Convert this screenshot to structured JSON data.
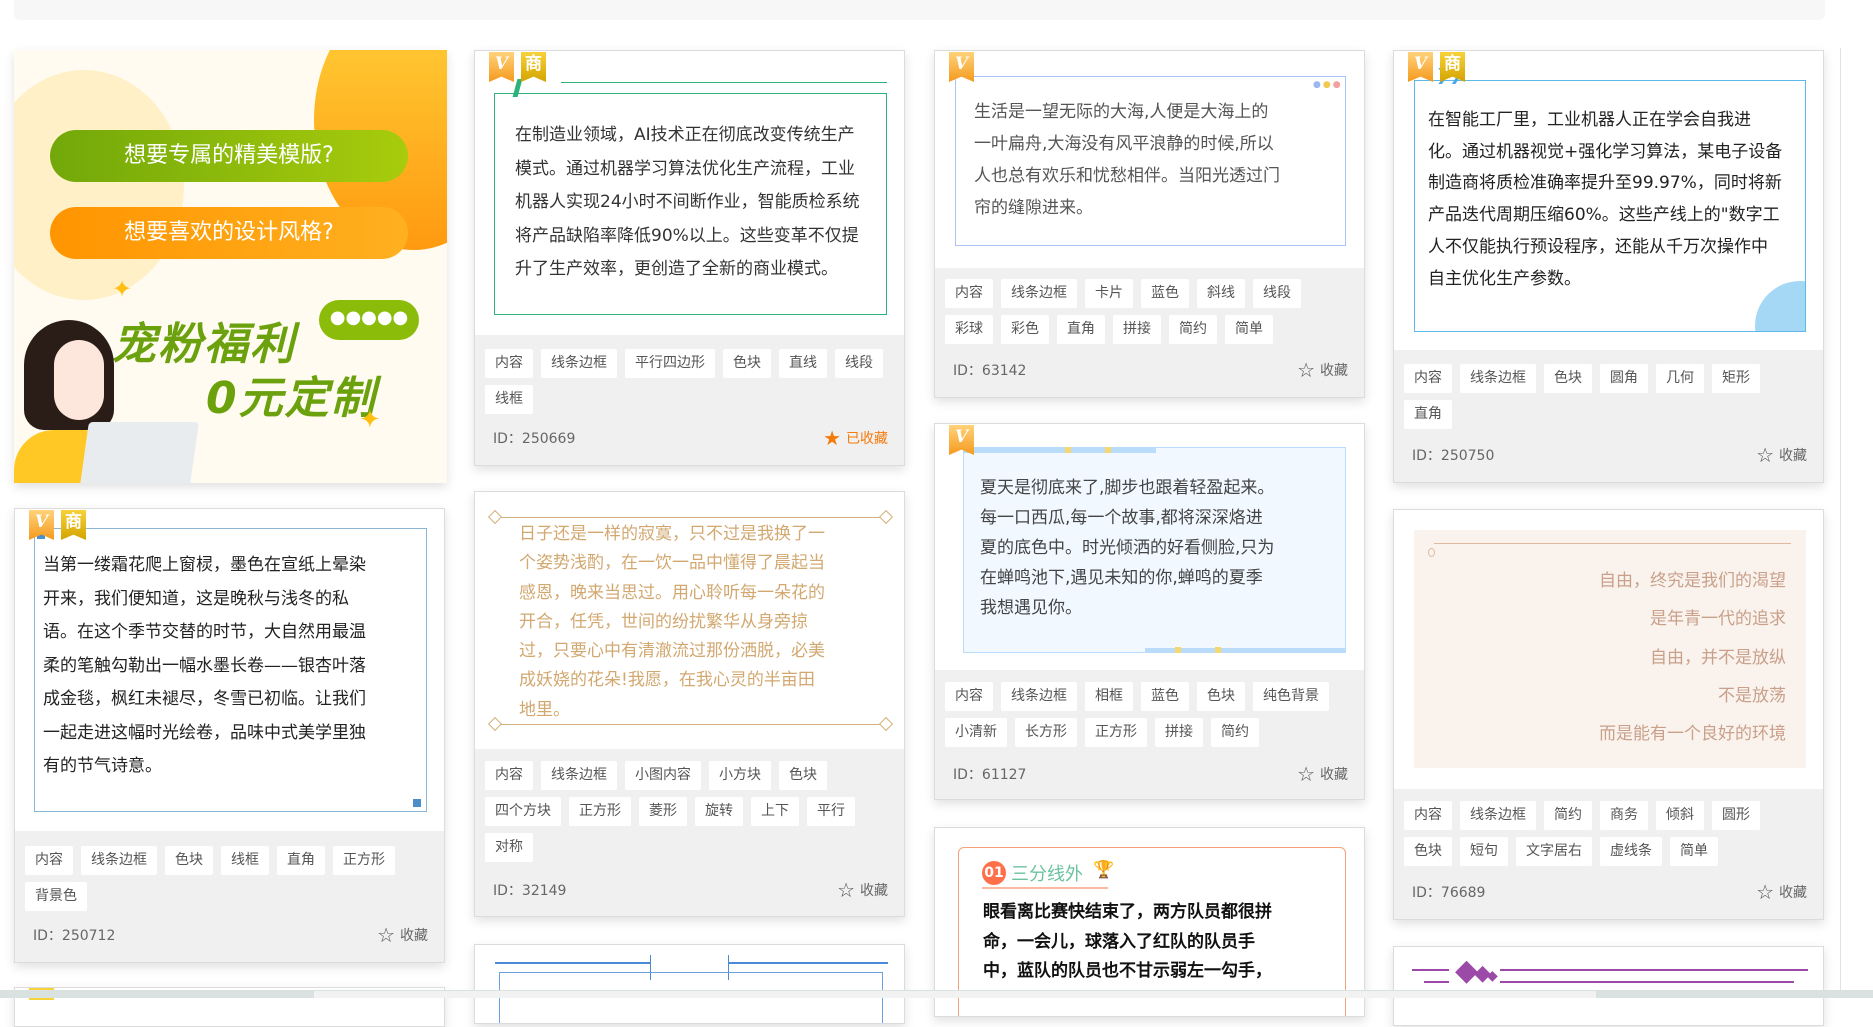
{
  "banner": {
    "line1": "想要专属的精美模版?",
    "line2": "想要喜欢的设计风格?",
    "promo1": "宠粉福利",
    "promo2": "0元定制",
    "colors": {
      "green": "#8cbc0a",
      "orange": "#ff9f1a"
    }
  },
  "badges": {
    "v": "V",
    "shang": "商"
  },
  "favorite_label": "收藏",
  "favorited_label": "已收藏",
  "id_prefix": "ID：",
  "cards": [
    {
      "id": "250669",
      "favorited": true,
      "badges": [
        "v",
        "shang"
      ],
      "lines": [
        "在制造业领域，AI技术正在彻底改变传统生产",
        "模式。通过机器学习算法优化生产流程，工业",
        "机器人实现24小时不间断作业，智能质检系统",
        "将产品缺陷率降低90%以上。这些变革不仅提",
        "升了生产效率，更创造了全新的商业模式。"
      ],
      "tags": [
        "内容",
        "线条边框",
        "平行四边形",
        "色块",
        "直线",
        "线段",
        "线框"
      ]
    },
    {
      "id": "32149",
      "favorited": false,
      "badges": [],
      "lines": [
        "日子还是一样的寂寞，只不过是我换了一",
        "个姿势浅酌，在一饮一品中懂得了晨起当",
        "感恩，晚来当思过。用心聆听每一朵花的",
        "开合，任凭，世间的纷扰繁华从身旁掠",
        "过，只要心中有清澈流过那份洒脱，必美",
        "成妖娆的花朵!我愿，在我心灵的半亩田",
        "地里。"
      ],
      "tags": [
        "内容",
        "线条边框",
        "小图内容",
        "小方块",
        "色块",
        "四个方块",
        "正方形",
        "菱形",
        "旋转",
        "上下",
        "平行",
        "对称"
      ]
    },
    {
      "id": "250712",
      "favorited": false,
      "badges": [
        "v",
        "shang"
      ],
      "lines": [
        "当第一缕霜花爬上窗棂，墨色在宣纸上晕染",
        "开来，我们便知道，这是晚秋与浅冬的私",
        "语。在这个季节交替的时节，大自然用最温",
        "柔的笔触勾勒出一幅水墨长卷——银杏叶落",
        "成金毯，枫红未褪尽，冬雪已初临。让我们",
        "一起走进这幅时光绘卷，品味中式美学里独",
        "有的节气诗意。"
      ],
      "tags": [
        "内容",
        "线条边框",
        "色块",
        "线框",
        "直角",
        "正方形",
        "背景色"
      ]
    },
    {
      "id": "63142",
      "favorited": false,
      "badges": [
        "v"
      ],
      "lines": [
        "生活是一望无际的大海,人便是大海上的",
        "一叶扁舟,大海没有风平浪静的时候,所以",
        "人也总有欢乐和忧愁相伴。当阳光透过门",
        "帘的缝隙进来。"
      ],
      "tags": [
        "内容",
        "线条边框",
        "卡片",
        "蓝色",
        "斜线",
        "线段",
        "彩球",
        "彩色",
        "直角",
        "拼接",
        "简约",
        "简单"
      ]
    },
    {
      "id": "61127",
      "favorited": false,
      "badges": [
        "v"
      ],
      "lines": [
        "夏天是彻底来了,脚步也跟着轻盈起来。",
        "每一口西瓜,每一个故事,都将深深烙进",
        "夏的底色中。时光倾洒的好看侧脸,只为",
        "在蝉鸣池下,遇见未知的你,蝉鸣的夏季",
        "我想遇见你。"
      ],
      "tags": [
        "内容",
        "线条边框",
        "相框",
        "蓝色",
        "色块",
        "纯色背景",
        "小清新",
        "长方形",
        "正方形",
        "拼接",
        "简约"
      ]
    },
    {
      "id": "250750",
      "favorited": false,
      "badges": [
        "v",
        "shang"
      ],
      "lines": [
        "在智能工厂里，工业机器人正在学会自我进",
        "化。通过机器视觉+强化学习算法，某电子设备",
        "制造商将质检准确率提升至99.97%，同时将新",
        "产品迭代周期压缩60%。这些产线上的\"数字工",
        "人不仅能执行预设程序，还能从千万次操作中",
        "自主优化生产参数。"
      ],
      "tags": [
        "内容",
        "线条边框",
        "色块",
        "圆角",
        "几何",
        "矩形",
        "直角"
      ]
    },
    {
      "id": "76689",
      "favorited": false,
      "badges": [],
      "lines": [
        "自由，终究是我们的渴望",
        "是年青一代的追求",
        "自由，并不是放纵",
        "不是放荡",
        "而是能有一个良好的环境"
      ],
      "tags": [
        "内容",
        "线条边框",
        "简约",
        "商务",
        "倾斜",
        "圆形",
        "色块",
        "短句",
        "文字居右",
        "虚线条",
        "简单"
      ]
    },
    {
      "number": "01",
      "heading": "三分线外",
      "lines": [
        "眼看离比赛快结束了，两方队员都很拼",
        "命，一会儿，球落入了红队的队员手",
        "中，蓝队的队员也不甘示弱左一勾手，"
      ]
    }
  ],
  "colors": {
    "favorited": "#f47a0c",
    "footer_bg": "#f0f0f0"
  }
}
